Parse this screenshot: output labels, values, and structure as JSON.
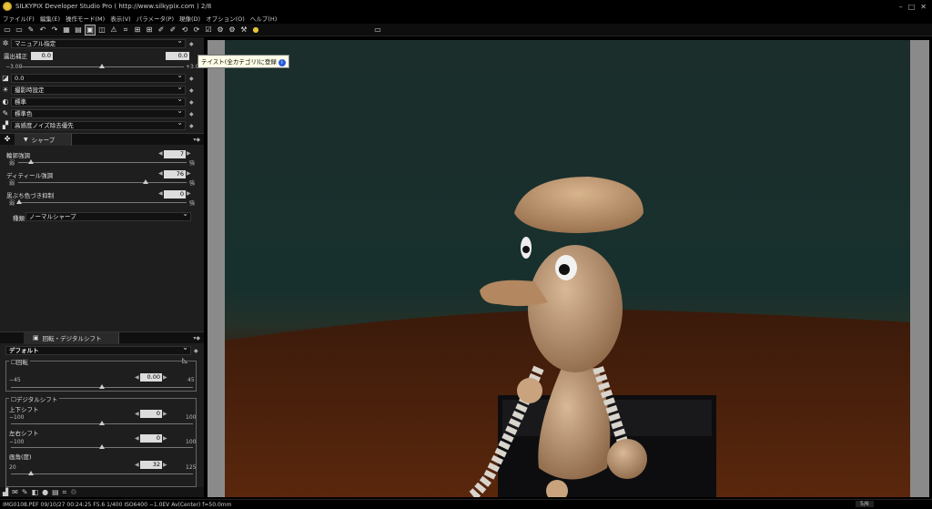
{
  "window": {
    "title": "SILKYPIX Developer Studio Pro ( http://www.silkypix.com )  2/8"
  },
  "menu": [
    "ファイル(F)",
    "編集(E)",
    "操作モード(M)",
    "表示(V)",
    "パラメータ(P)",
    "現像(D)",
    "オプション(O)",
    "ヘルプ(H)"
  ],
  "tooltip": {
    "text": "テイスト(全カテゴリ)に登録"
  },
  "panel": {
    "wb": "マニュアル指定",
    "exposure": {
      "label": "露出補正",
      "value": "0.0",
      "value2": "0.0",
      "min": "−3.00",
      "max": "+3.00"
    },
    "contrast": "0.0",
    "shooting": "撮影時設定",
    "standard1": "標準",
    "standard2": "標準色",
    "noise": "高感度ノイズ除去優先"
  },
  "sharp": {
    "tab": "シャープ",
    "outline": {
      "label": "輪郭強調",
      "value": "7",
      "min": "弱",
      "max": "強"
    },
    "detail": {
      "label": "ディティール強調",
      "value": "76",
      "min": "弱",
      "max": "強"
    },
    "black": {
      "label": "黒ぶち色づき抑制",
      "value": "0",
      "min": "弱",
      "max": "強"
    },
    "type_label": "種類",
    "type_value": "ノーマルシャープ"
  },
  "rotate": {
    "tab": "回転・デジタルシフト",
    "preset": "デフォルト",
    "rotate_label": "回転",
    "rot": {
      "value": "0.00",
      "min": "−45",
      "max": "45"
    },
    "shift_label": "デジタルシフト",
    "vertical": {
      "label": "上下シフト",
      "value": "0",
      "min": "−100",
      "max": "100"
    },
    "horizontal": {
      "label": "左右シフト",
      "value": "0",
      "min": "−100",
      "max": "100"
    },
    "angle": {
      "label": "画角(度)",
      "value": "32",
      "min": "20",
      "max": "125"
    }
  },
  "status": {
    "info": "IMG0108.PEF 09/10/27 00:24:25 F5.6 1/400 ISO6400 −1.0EV Av(Center) f=50.0mm",
    "page": "5/6"
  }
}
